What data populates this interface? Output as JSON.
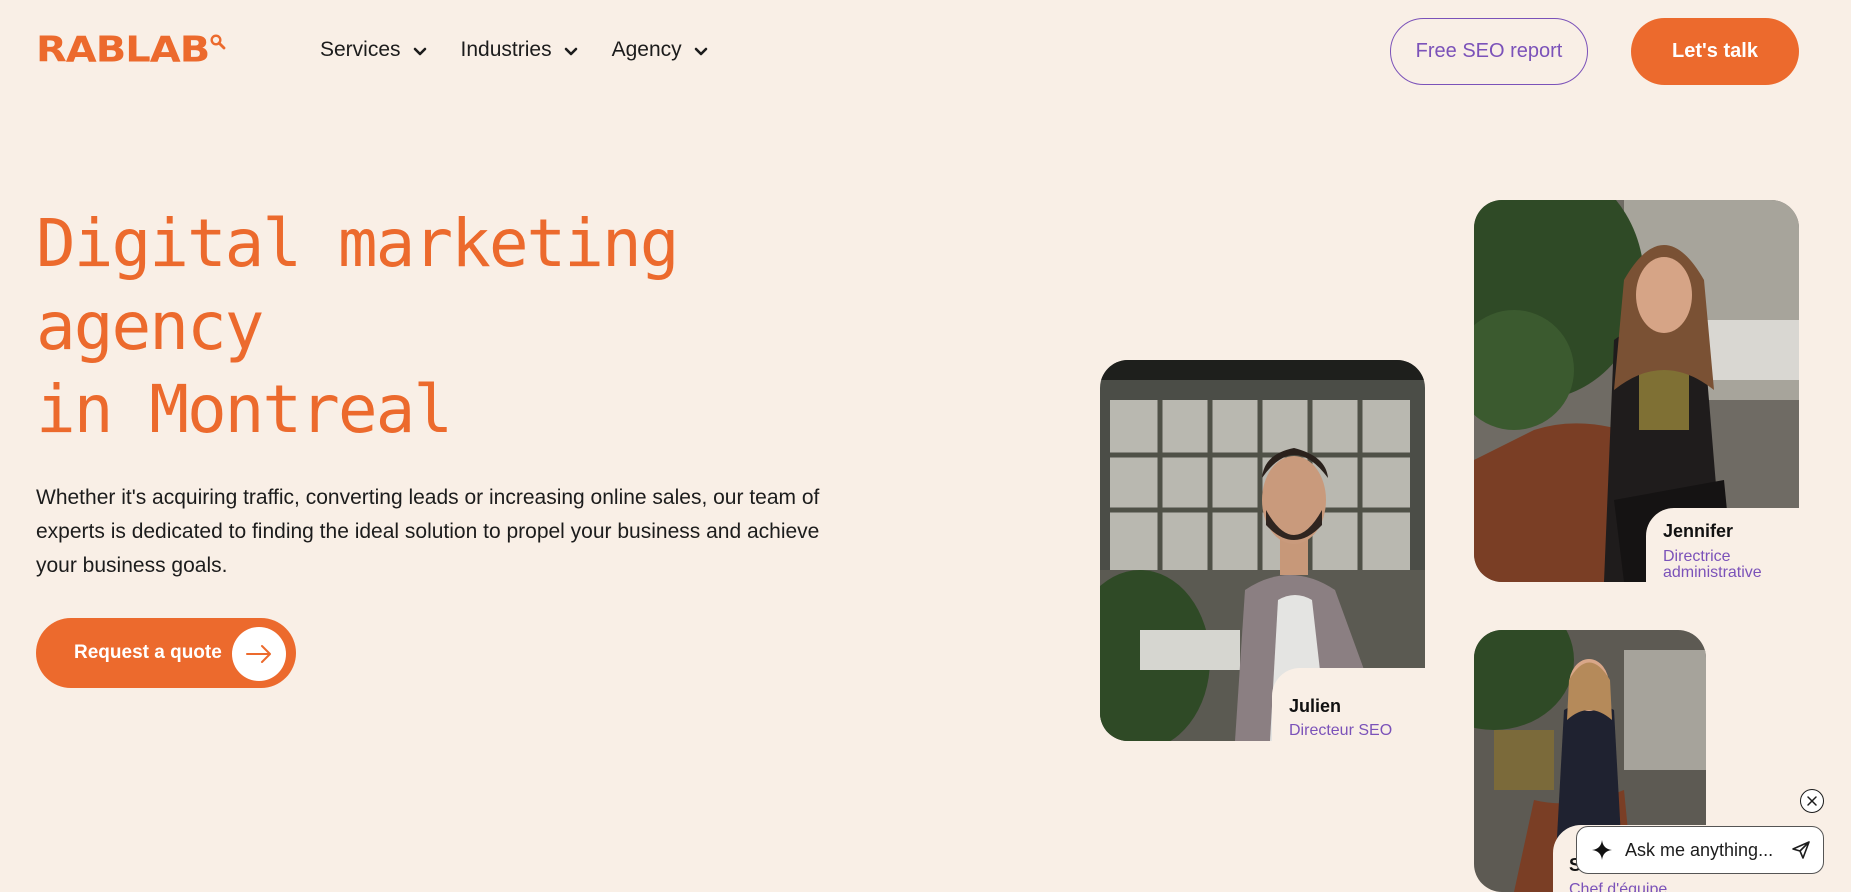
{
  "brand": {
    "name": "RABLAB",
    "color": "#ec6a2d",
    "accent": "#7b52b9"
  },
  "nav": {
    "items": [
      {
        "label": "Services"
      },
      {
        "label": "Industries"
      },
      {
        "label": "Agency"
      }
    ]
  },
  "header_buttons": {
    "seo_report": "Free SEO report",
    "contact": "Let's talk"
  },
  "hero": {
    "title_lines": [
      "Digital marketing",
      "agency",
      "in Montreal"
    ],
    "description": "Whether it's acquiring traffic, converting leads or increasing online sales, our team of experts is dedicated to finding the ideal solution to propel your business and achieve your business goals.",
    "cta_label": "Request a quote"
  },
  "team": [
    {
      "name": "Julien",
      "role": "Directeur SEO"
    },
    {
      "name": "Jennifer",
      "role_lines": [
        "Directrice",
        "administrative"
      ]
    },
    {
      "name": "St",
      "role": "Chef d'équipe"
    }
  ],
  "chat": {
    "placeholder": "Ask me anything..."
  },
  "icons": {
    "nav_chevron": "chevron-down-icon",
    "cta_arrow": "arrow-right-icon",
    "chat_sparkle": "sparkle-icon",
    "chat_send": "send-icon",
    "chat_close": "close-icon"
  }
}
